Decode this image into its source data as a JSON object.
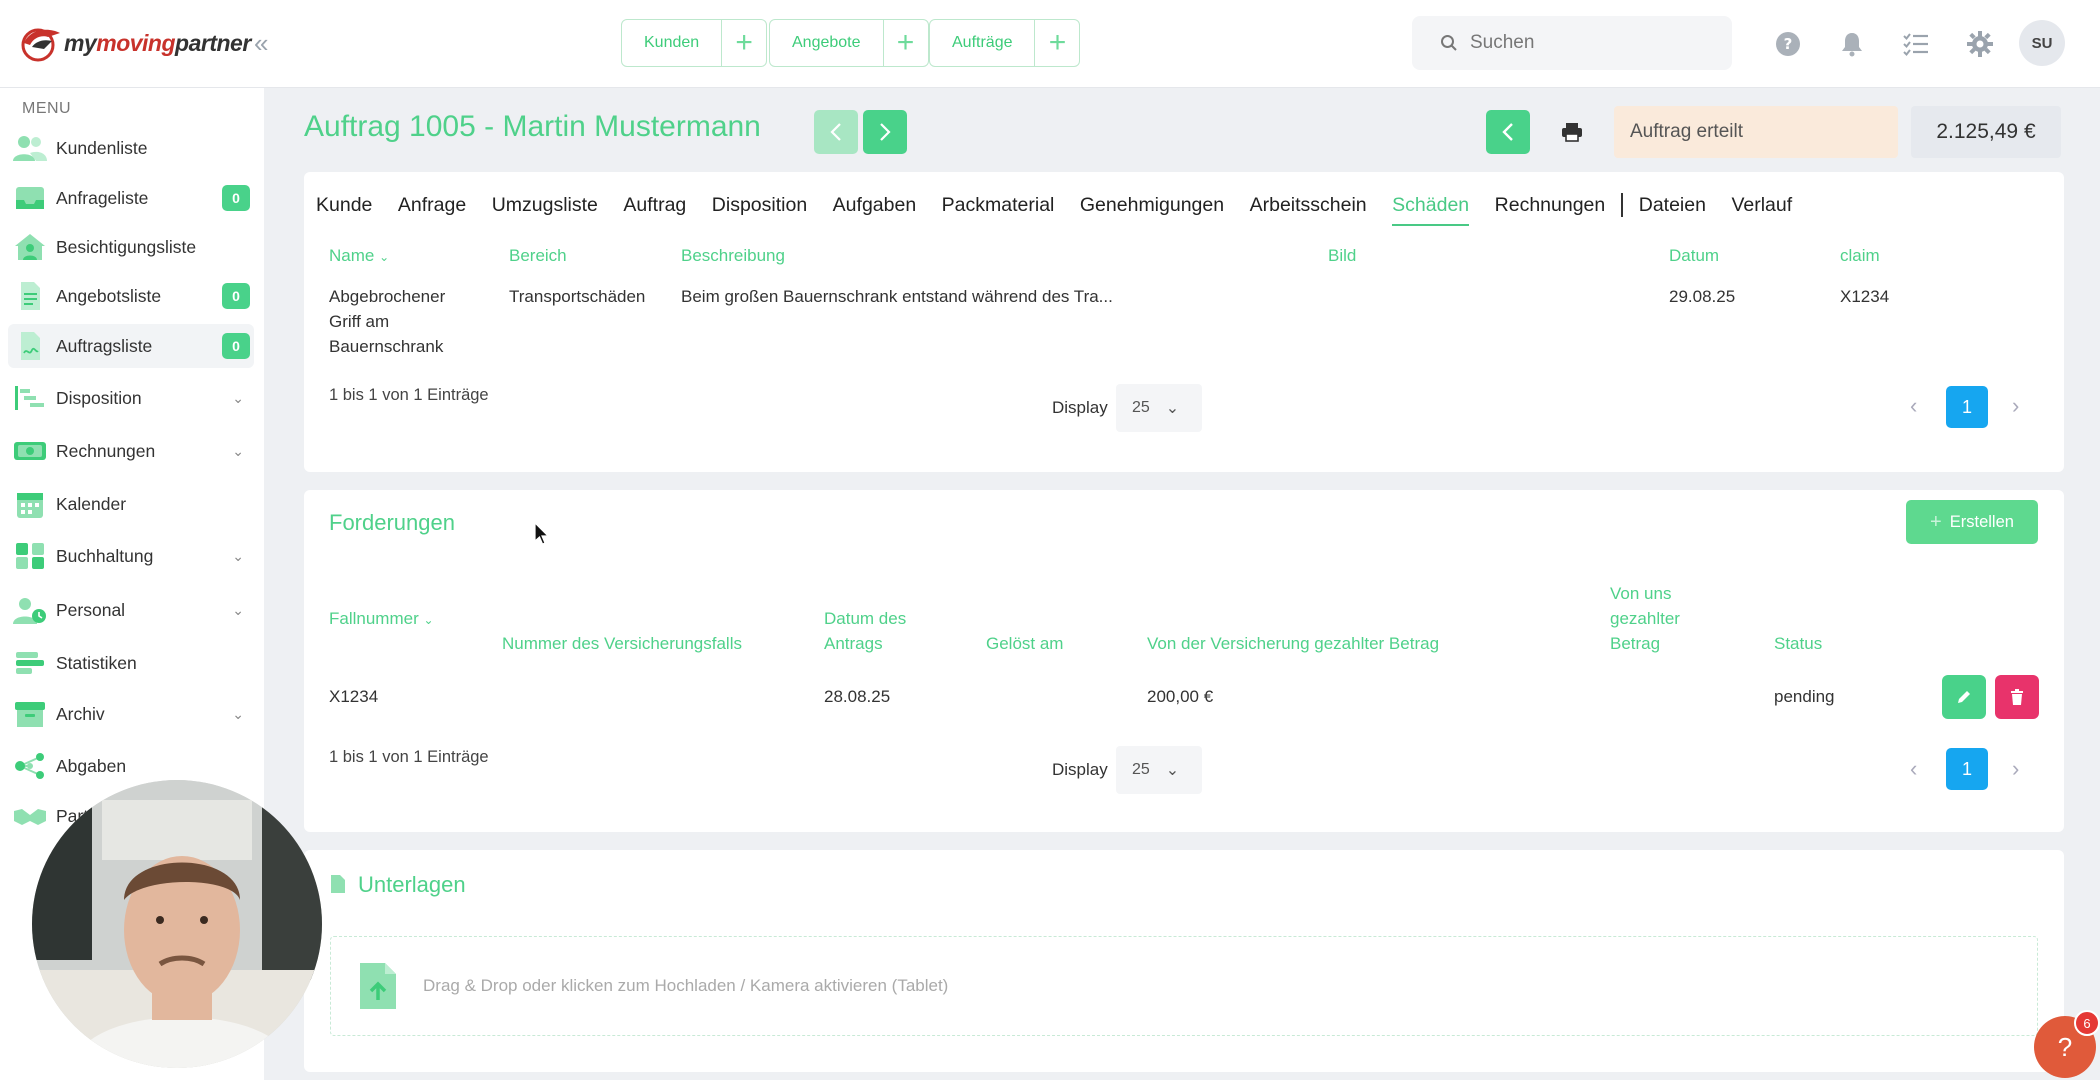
{
  "brand": {
    "name_part1": "my",
    "name_part2": "moving",
    "name_part3": "partner"
  },
  "quick_actions": [
    {
      "label": "Kunden"
    },
    {
      "label": "Angebote"
    },
    {
      "label": "Aufträge"
    }
  ],
  "search": {
    "placeholder": "Suchen"
  },
  "user": {
    "initials": "SU"
  },
  "sidebar": {
    "menu_label": "MENU",
    "items": [
      {
        "label": "Kundenliste",
        "badge": null,
        "chevron": false
      },
      {
        "label": "Anfrageliste",
        "badge": "0",
        "chevron": false
      },
      {
        "label": "Besichtigungsliste",
        "badge": null,
        "chevron": false
      },
      {
        "label": "Angebotsliste",
        "badge": "0",
        "chevron": false
      },
      {
        "label": "Auftragsliste",
        "badge": "0",
        "chevron": false
      },
      {
        "label": "Disposition",
        "badge": null,
        "chevron": true
      },
      {
        "label": "Rechnungen",
        "badge": null,
        "chevron": true
      },
      {
        "label": "Kalender",
        "badge": null,
        "chevron": false
      },
      {
        "label": "Buchhaltung",
        "badge": null,
        "chevron": true
      },
      {
        "label": "Personal",
        "badge": null,
        "chevron": true
      },
      {
        "label": "Statistiken",
        "badge": null,
        "chevron": false
      },
      {
        "label": "Archiv",
        "badge": null,
        "chevron": true
      },
      {
        "label": "Abgaben",
        "badge": null,
        "chevron": false
      },
      {
        "label": "Part",
        "badge": null,
        "chevron": false
      }
    ]
  },
  "header": {
    "title": "Auftrag 1005 - Martin Mustermann",
    "status": "Auftrag erteilt",
    "amount": "2.125,49 €"
  },
  "tabs": [
    {
      "label": "Kunde"
    },
    {
      "label": "Anfrage"
    },
    {
      "label": "Umzugsliste"
    },
    {
      "label": "Auftrag"
    },
    {
      "label": "Disposition"
    },
    {
      "label": "Aufgaben"
    },
    {
      "label": "Packmaterial"
    },
    {
      "label": "Genehmigungen"
    },
    {
      "label": "Arbeitsschein"
    },
    {
      "label": "Schäden"
    },
    {
      "label": "Rechnungen"
    },
    {
      "label": "Dateien"
    },
    {
      "label": "Verlauf"
    }
  ],
  "damages": {
    "columns": [
      "Name",
      "Bereich",
      "Beschreibung",
      "Bild",
      "Datum",
      "claim"
    ],
    "rows": [
      {
        "name_line1": "Abgebrochener",
        "name_line2": "Griff am",
        "name_line3": "Bauernschrank",
        "bereich": "Transportschäden",
        "beschreibung": "Beim großen Bauernschrank entstand während des Tra...",
        "bild": "",
        "datum": "29.08.25",
        "claim": "X1234"
      }
    ],
    "info": "1 bis 1 von 1 Einträge",
    "display_label": "Display",
    "page_size": "25",
    "page": "1"
  },
  "claims": {
    "title": "Forderungen",
    "create_label": "Erstellen",
    "columns": {
      "fallnummer": "Fallnummer",
      "versicherungsfall": "Nummer des Versicherungsfalls",
      "datum_l1": "Datum des",
      "datum_l2": "Antrags",
      "geloest": "Gelöst am",
      "versicherung_betrag": "Von der Versicherung gezahlter Betrag",
      "uns_l1": "Von uns",
      "uns_l2": "gezahlter",
      "uns_l3": "Betrag",
      "status": "Status"
    },
    "rows": [
      {
        "fallnummer": "X1234",
        "versicherungsfall": "",
        "datum": "28.08.25",
        "geloest": "",
        "versicherung_betrag": "200,00 €",
        "uns_betrag": "",
        "status": "pending"
      }
    ],
    "info": "1 bis 1 von 1 Einträge",
    "display_label": "Display",
    "page_size": "25",
    "page": "1"
  },
  "documents": {
    "title": "Unterlagen",
    "dropzone_text": "Drag & Drop oder klicken zum Hochladen / Kamera aktivieren (Tablet)"
  },
  "help": {
    "count": "6",
    "label": "?"
  },
  "colors": {
    "accent": "#4fd18a",
    "danger": "#e8336b",
    "primary": "#16a6f0",
    "status_bg": "#faeadb"
  }
}
